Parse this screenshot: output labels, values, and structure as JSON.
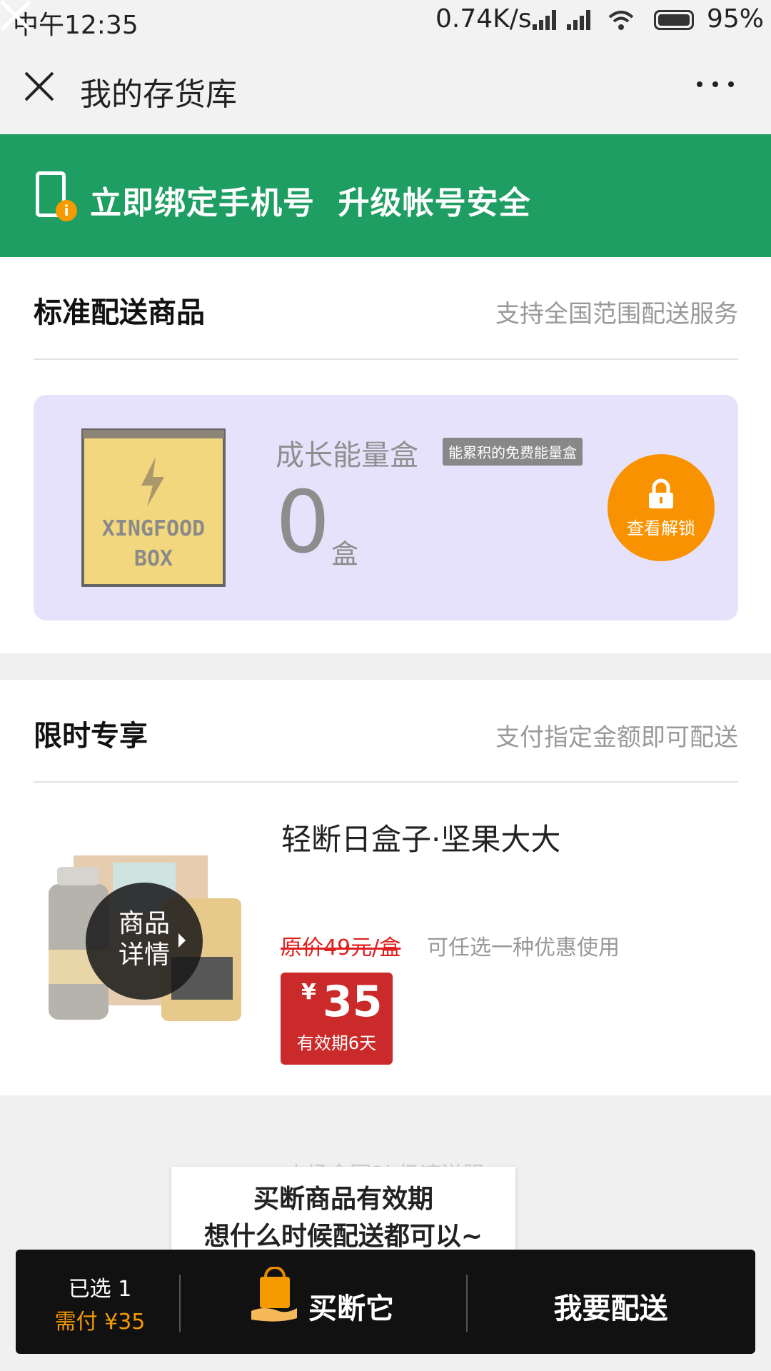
{
  "status_bar": {
    "time": "中午12:35",
    "network_speed": "0.74K/s",
    "battery": "95%"
  },
  "header": {
    "title": "我的存货库"
  },
  "banner": {
    "text": "立即绑定手机号  升级帐号安全",
    "bg_color": "#1f9e63"
  },
  "standard_section": {
    "title": "标准配送商品",
    "subtitle": "支持全国范围配送服务",
    "energy_box": {
      "image_text_line1": "XINGFOOD",
      "image_text_line2": "BOX",
      "title": "成长能量盒",
      "tag": "能累积的免费能量盒",
      "count": "0",
      "unit": "盒",
      "unlock_label": "查看解锁"
    }
  },
  "limited_section": {
    "title": "限时专享",
    "subtitle": "支付指定金额即可配送",
    "product": {
      "name": "轻断日盒子·坚果大大",
      "details_label": "商品详情",
      "original_price": "原价49元/盒",
      "hint": "可任选一种优惠使用",
      "currency": "¥",
      "price": "35",
      "validity": "有效期6天"
    }
  },
  "tooltip": {
    "line1": "买断商品有效期",
    "line2": "想什么时候配送都可以~",
    "faded_text": "本场全国2h极速送服"
  },
  "bottom_bar": {
    "selected": "已选 1",
    "pay": "需付 ¥35",
    "buy_button": "买断它",
    "deliver_button": "我要配送"
  },
  "colors": {
    "accent_orange": "#f99200",
    "price_red": "#cb2a2a",
    "energy_bg": "#e6e2fb"
  }
}
